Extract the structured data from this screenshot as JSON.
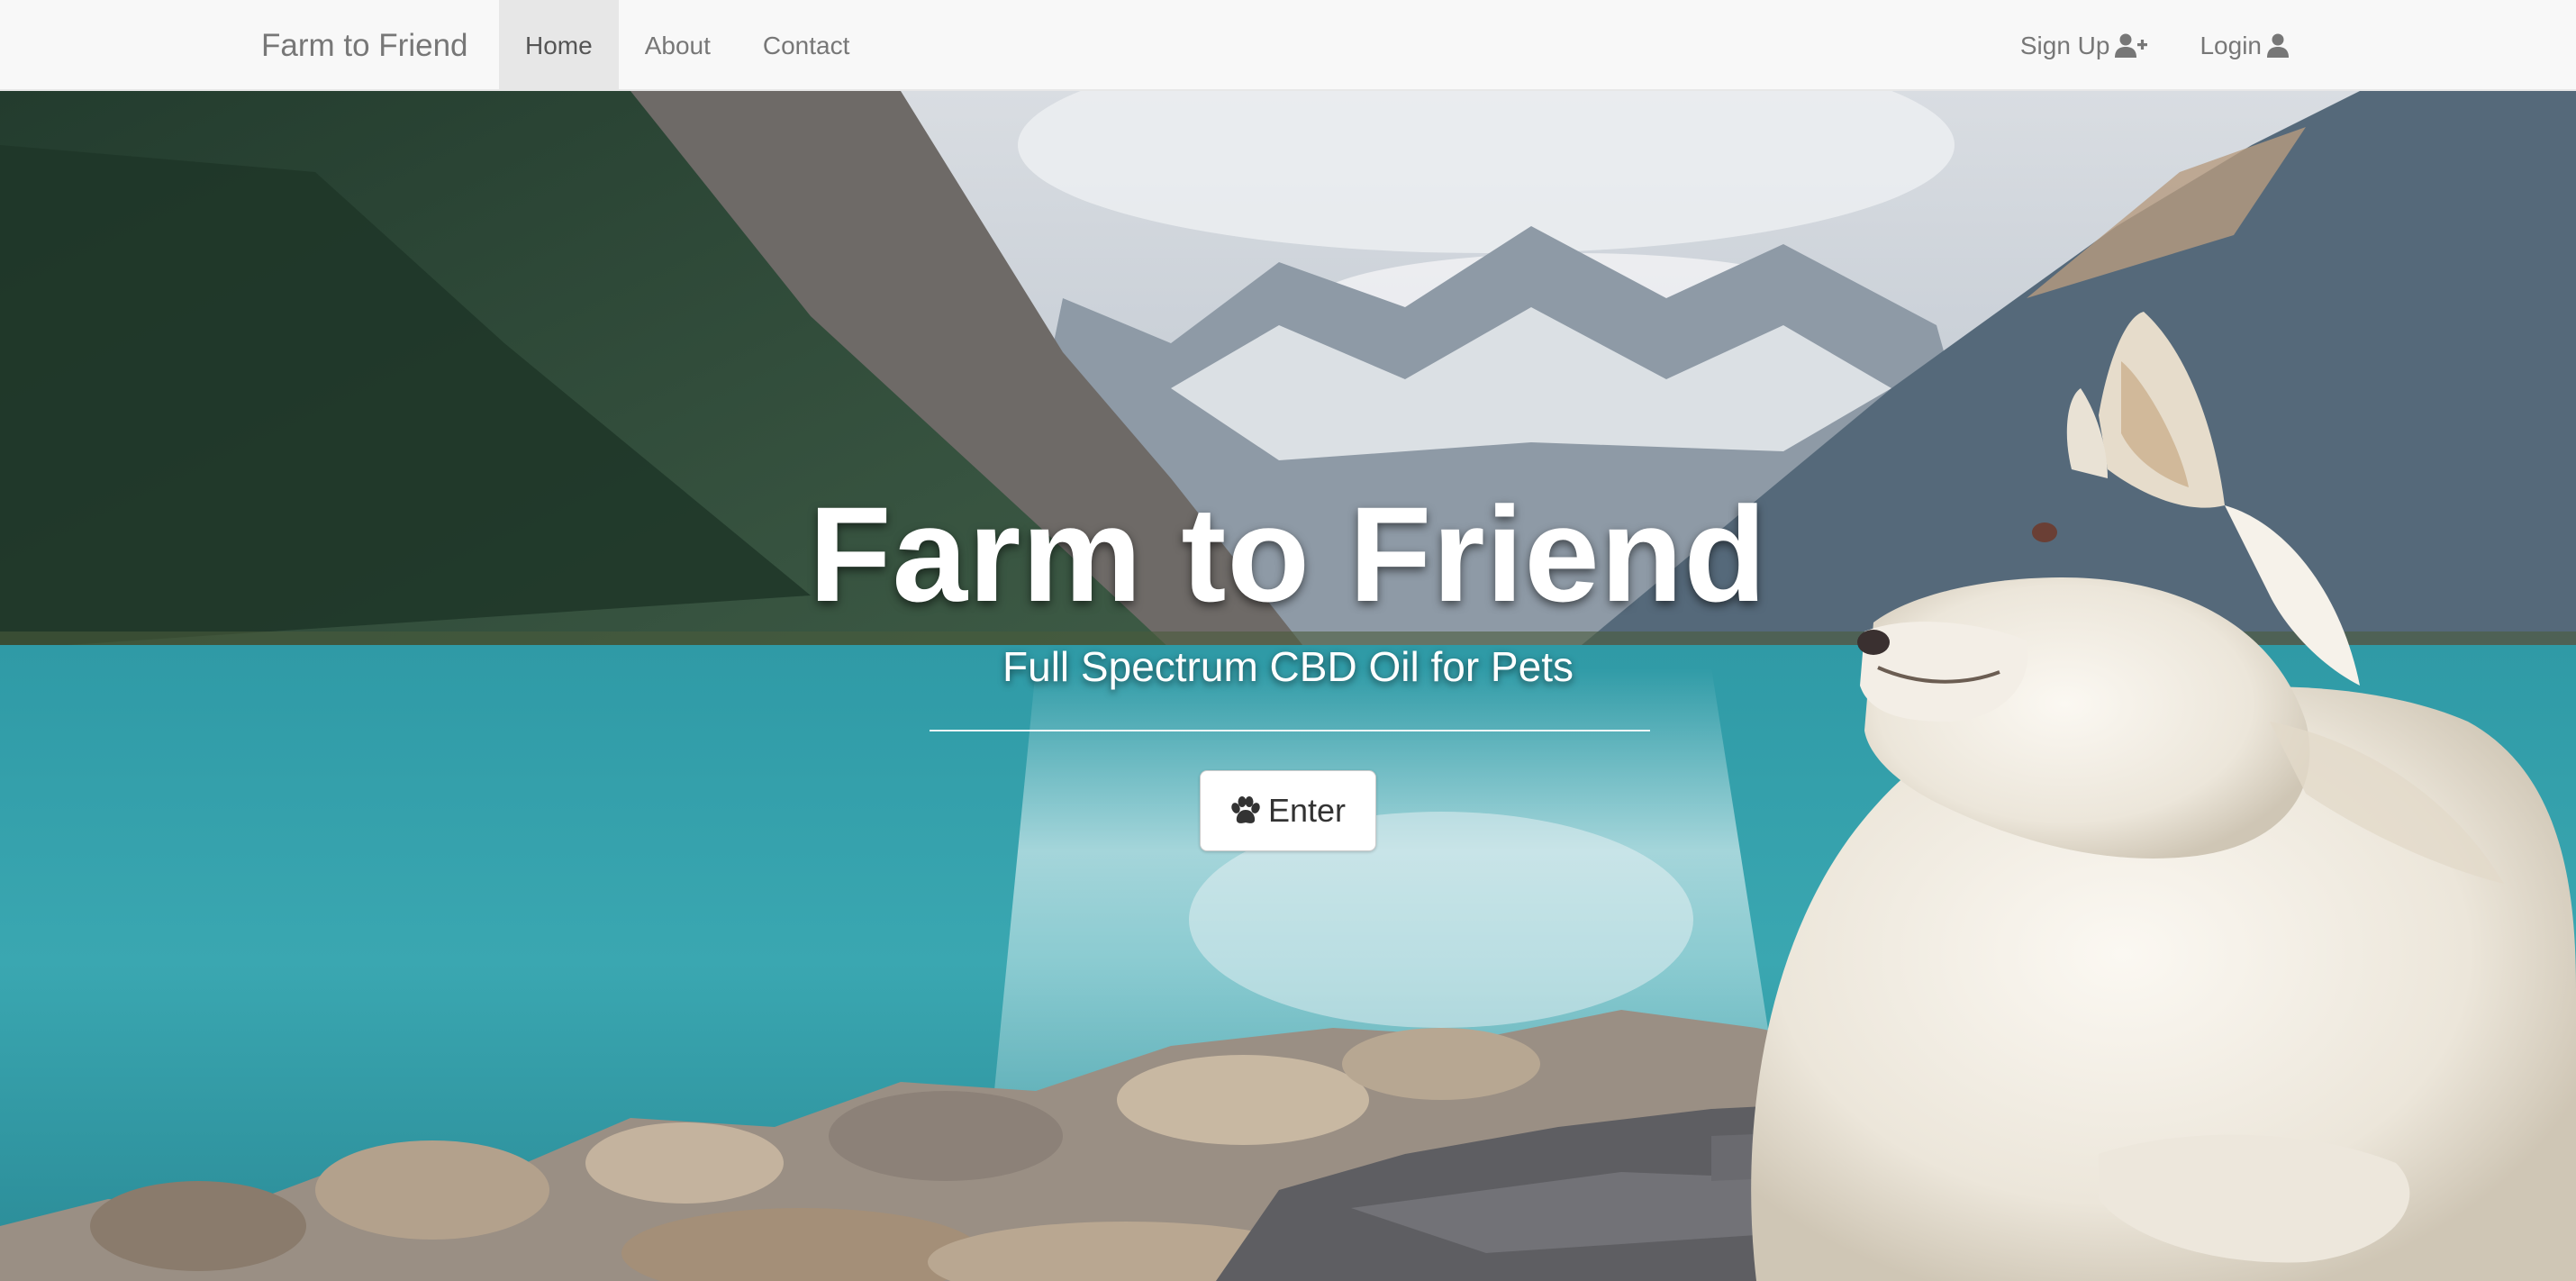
{
  "navbar": {
    "brand": "Farm to Friend",
    "links": [
      {
        "label": "Home",
        "active": true
      },
      {
        "label": "About"
      },
      {
        "label": "Contact"
      }
    ],
    "right": [
      {
        "label": "Sign Up",
        "icon": "user-plus-icon"
      },
      {
        "label": "Login",
        "icon": "user-icon"
      }
    ]
  },
  "hero": {
    "title": "Farm to Friend",
    "subtitle": "Full Spectrum CBD Oil for Pets",
    "button": {
      "label": "Enter",
      "icon": "paw-icon"
    }
  },
  "colors": {
    "navbar_bg": "#f8f8f8",
    "nav_text": "#777777",
    "lake": "#3fa3ad",
    "hero_text": "#ffffff"
  }
}
